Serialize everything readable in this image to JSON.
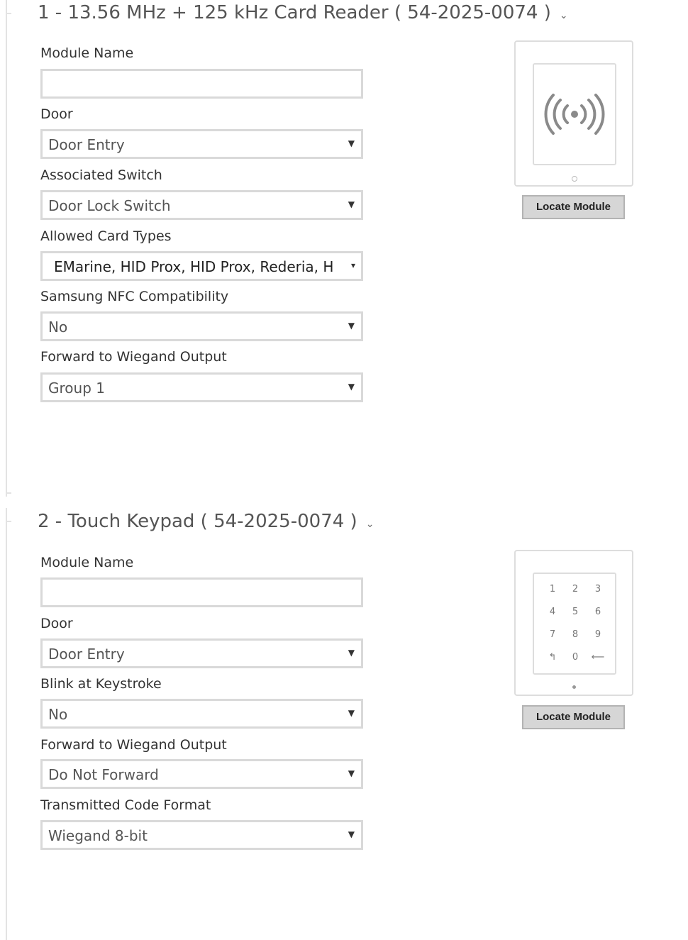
{
  "section1": {
    "title": "1 - 13.56 MHz + 125 kHz Card Reader ( 54-2025-0074 )",
    "chevron_icon": "chevron-down-icon",
    "fields": {
      "module_name": {
        "label": "Module Name",
        "value": ""
      },
      "door": {
        "label": "Door",
        "value": "Door Entry"
      },
      "associated_switch": {
        "label": "Associated Switch",
        "value": "Door Lock Switch"
      },
      "allowed_card_types": {
        "label": "Allowed Card Types",
        "value": "EMarine, HID Prox, HID Prox, Rederia, H"
      },
      "samsung_nfc": {
        "label": "Samsung NFC Compatibility",
        "value": "No"
      },
      "forward_wiegand": {
        "label": "Forward to Wiegand Output",
        "value": "Group 1"
      }
    },
    "module_image_icon": "rfid-wireless-icon",
    "locate_button": "Locate Module"
  },
  "section2": {
    "title": "2 - Touch Keypad ( 54-2025-0074 )",
    "chevron_icon": "chevron-down-icon",
    "fields": {
      "module_name": {
        "label": "Module Name",
        "value": ""
      },
      "door": {
        "label": "Door",
        "value": "Door Entry"
      },
      "blink_keystroke": {
        "label": "Blink at Keystroke",
        "value": "No"
      },
      "forward_wiegand": {
        "label": "Forward to Wiegand Output",
        "value": "Do Not Forward"
      },
      "code_format": {
        "label": "Transmitted Code Format",
        "value": "Wiegand 8-bit"
      }
    },
    "keypad_keys": [
      "1",
      "2",
      "3",
      "4",
      "5",
      "6",
      "7",
      "8",
      "9",
      "↰",
      "0",
      "⟵"
    ],
    "locate_button": "Locate Module"
  },
  "dropdown_arrow": "▼",
  "multi_arrow": "▾",
  "colors": {
    "border": "#d9d9d9",
    "button_bg": "#d6d6d6",
    "title_text": "#555555"
  }
}
